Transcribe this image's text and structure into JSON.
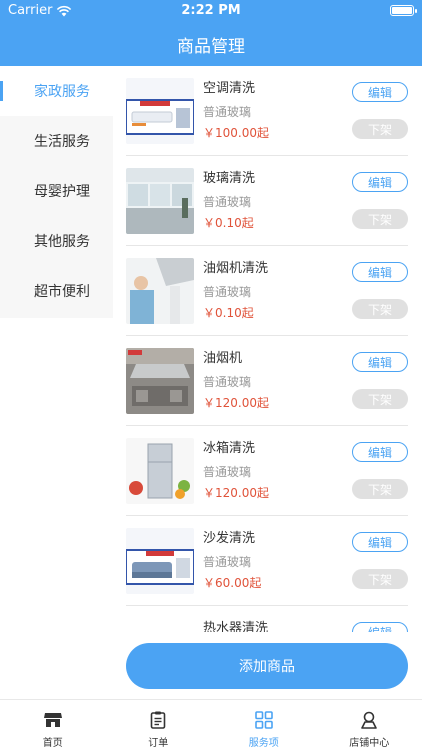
{
  "status_bar": {
    "carrier": "Carrier",
    "time": "2:22 PM",
    "icons": [
      "wifi-icon",
      "battery-icon"
    ]
  },
  "header": {
    "title": "商品管理"
  },
  "sidebar": {
    "items": [
      {
        "label": "家政服务",
        "active": true
      },
      {
        "label": "生活服务",
        "active": false
      },
      {
        "label": "母婴护理",
        "active": false
      },
      {
        "label": "其他服务",
        "active": false
      },
      {
        "label": "超市便利",
        "active": false
      }
    ]
  },
  "products": [
    {
      "name": "空调清洗",
      "subtitle": "普通玻璃",
      "price": "￥100.00起",
      "edit_label": "编辑",
      "off_label": "下架"
    },
    {
      "name": "玻璃清洗",
      "subtitle": "普通玻璃",
      "price": "￥0.10起",
      "edit_label": "编辑",
      "off_label": "下架"
    },
    {
      "name": "油烟机清洗",
      "subtitle": "普通玻璃",
      "price": "￥0.10起",
      "edit_label": "编辑",
      "off_label": "下架"
    },
    {
      "name": "油烟机",
      "subtitle": "普通玻璃",
      "price": "￥120.00起",
      "edit_label": "编辑",
      "off_label": "下架"
    },
    {
      "name": "冰箱清洗",
      "subtitle": "普通玻璃",
      "price": "￥120.00起",
      "edit_label": "编辑",
      "off_label": "下架"
    },
    {
      "name": "沙发清洗",
      "subtitle": "普通玻璃",
      "price": "￥60.00起",
      "edit_label": "编辑",
      "off_label": "下架"
    },
    {
      "name": "热水器清洗",
      "subtitle": "",
      "price": "",
      "edit_label": "编辑",
      "off_label": ""
    }
  ],
  "add_button": {
    "label": "添加商品"
  },
  "tabbar": {
    "items": [
      {
        "label": "首页",
        "icon": "store-icon",
        "active": false
      },
      {
        "label": "订单",
        "icon": "clipboard-icon",
        "active": false
      },
      {
        "label": "服务项",
        "icon": "grid-icon",
        "active": true
      },
      {
        "label": "店铺中心",
        "icon": "user-icon",
        "active": false
      }
    ]
  },
  "colors": {
    "primary": "#4ba3f3",
    "price": "#e0533a",
    "disabled": "#e0e0e0"
  }
}
